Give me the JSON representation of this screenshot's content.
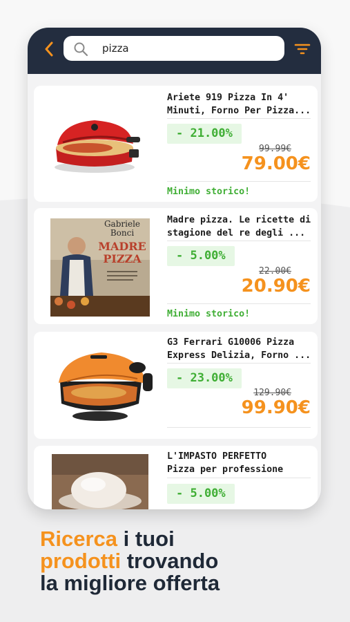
{
  "colors": {
    "header_bg": "#232d3f",
    "accent": "#f5921e",
    "discount_text": "#3fae34",
    "discount_bg": "#e6f7e4"
  },
  "search": {
    "query": "pizza",
    "back_icon": "chevron-left-icon",
    "search_icon": "magnifier-icon",
    "filter_icon": "filter-icon"
  },
  "products": [
    {
      "title": "Ariete 919 Pizza In 4'\nMinuti, Forno Per Pizza...",
      "discount": "- 21.00%",
      "old_price": "99.99€",
      "price": "79.00€",
      "note": "Minimo storico!",
      "image": "red-pizza-oven"
    },
    {
      "title": "Madre pizza. Le ricette di\nstagione del re degli ...",
      "discount": "- 5.00%",
      "old_price": "22.00€",
      "price": "20.90€",
      "note": "Minimo storico!",
      "image": "book-cover",
      "image_author_first": "Gabriele",
      "image_author_last": "Bonci",
      "image_title_1": "MADRE",
      "image_title_2": "PIZZA"
    },
    {
      "title": "G3 Ferrari G10006 Pizza\nExpress Delizia, Forno ...",
      "discount": "- 23.00%",
      "old_price": "129.90€",
      "price": "99.90€",
      "image": "orange-pizza-oven"
    },
    {
      "title": "L'IMPASTO PERFETTO\nPizza per professione",
      "discount": "- 5.00%",
      "image": "dough-ball"
    }
  ],
  "tagline": {
    "w1": "Ricerca",
    "w2": " i tuoi",
    "w3": "prodotti",
    "w4": " trovando",
    "w5": "la migliore offerta"
  }
}
